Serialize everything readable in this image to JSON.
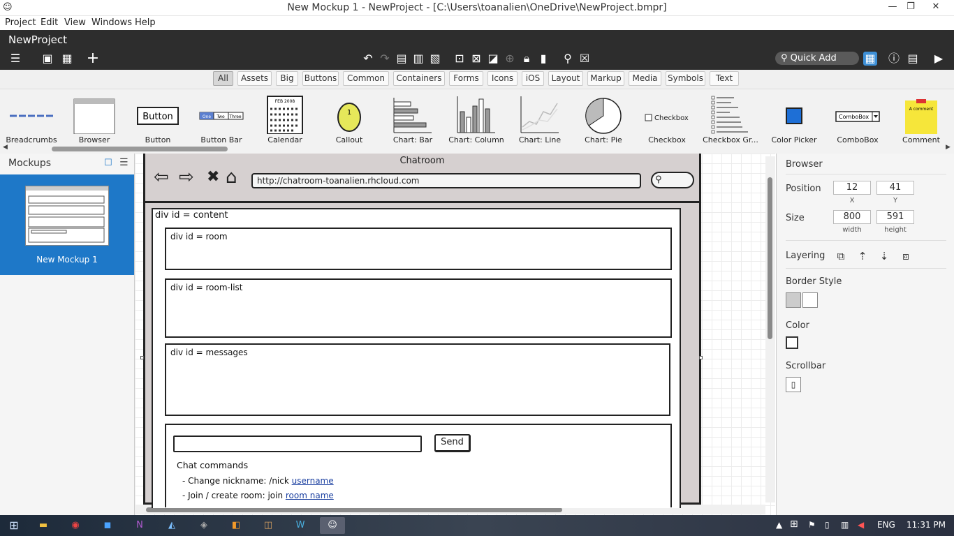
{
  "window": {
    "title": "New Mockup 1 - NewProject - [C:\\Users\\toanalien\\OneDrive\\NewProject.bmpr]"
  },
  "menubar": [
    "Project",
    "Edit",
    "View",
    "Windows",
    "Help"
  ],
  "toolbar": {
    "project_name": "NewProject",
    "quick_add": "Quick Add"
  },
  "categories": [
    "All",
    "Assets",
    "Big",
    "Buttons",
    "Common",
    "Containers",
    "Forms",
    "Icons",
    "iOS",
    "Layout",
    "Markup",
    "Media",
    "Symbols",
    "Text"
  ],
  "library": [
    "Breadcrumbs",
    "Browser",
    "Button",
    "Button Bar",
    "Calendar",
    "Callout",
    "Chart: Bar",
    "Chart: Column",
    "Chart: Line",
    "Chart: Pie",
    "Checkbox",
    "Checkbox Gr...",
    "Color Picker",
    "ComboBox",
    "Comment"
  ],
  "library_icons": {
    "button_text": "Button",
    "buttonbar": [
      "One",
      "Two",
      "Three"
    ],
    "calendar_month": "FEB 2008",
    "callout_num": "1",
    "checkbox_text": "Checkbox",
    "combobox_text": "ComboBox",
    "comment_text": "A comment"
  },
  "mockups": {
    "header": "Mockups",
    "items": [
      {
        "label": "New Mockup 1"
      }
    ]
  },
  "mockup": {
    "title": "Chatroom",
    "url": "http://chatroom-toanalien.rhcloud.com",
    "content_label": "div id = content",
    "room_label": "div id = room",
    "roomlist_label": "div id = room-list",
    "messages_label": "div id = messages",
    "send_label": "Send",
    "chat_commands": "Chat commands",
    "cmd1_prefix": "- Change nickname: /nick ",
    "cmd1_link": "username",
    "cmd2_prefix": "- Join / create room: join ",
    "cmd2_link": "room name"
  },
  "properties": {
    "title": "Browser",
    "position_label": "Position",
    "x": "12",
    "y": "41",
    "x_label": "X",
    "y_label": "Y",
    "size_label": "Size",
    "width": "800",
    "height": "591",
    "width_label": "width",
    "height_label": "height",
    "layering_label": "Layering",
    "border_style_label": "Border Style",
    "color_label": "Color",
    "scrollbar_label": "Scrollbar"
  },
  "taskbar": {
    "lang": "ENG",
    "time": "11:31 PM"
  }
}
